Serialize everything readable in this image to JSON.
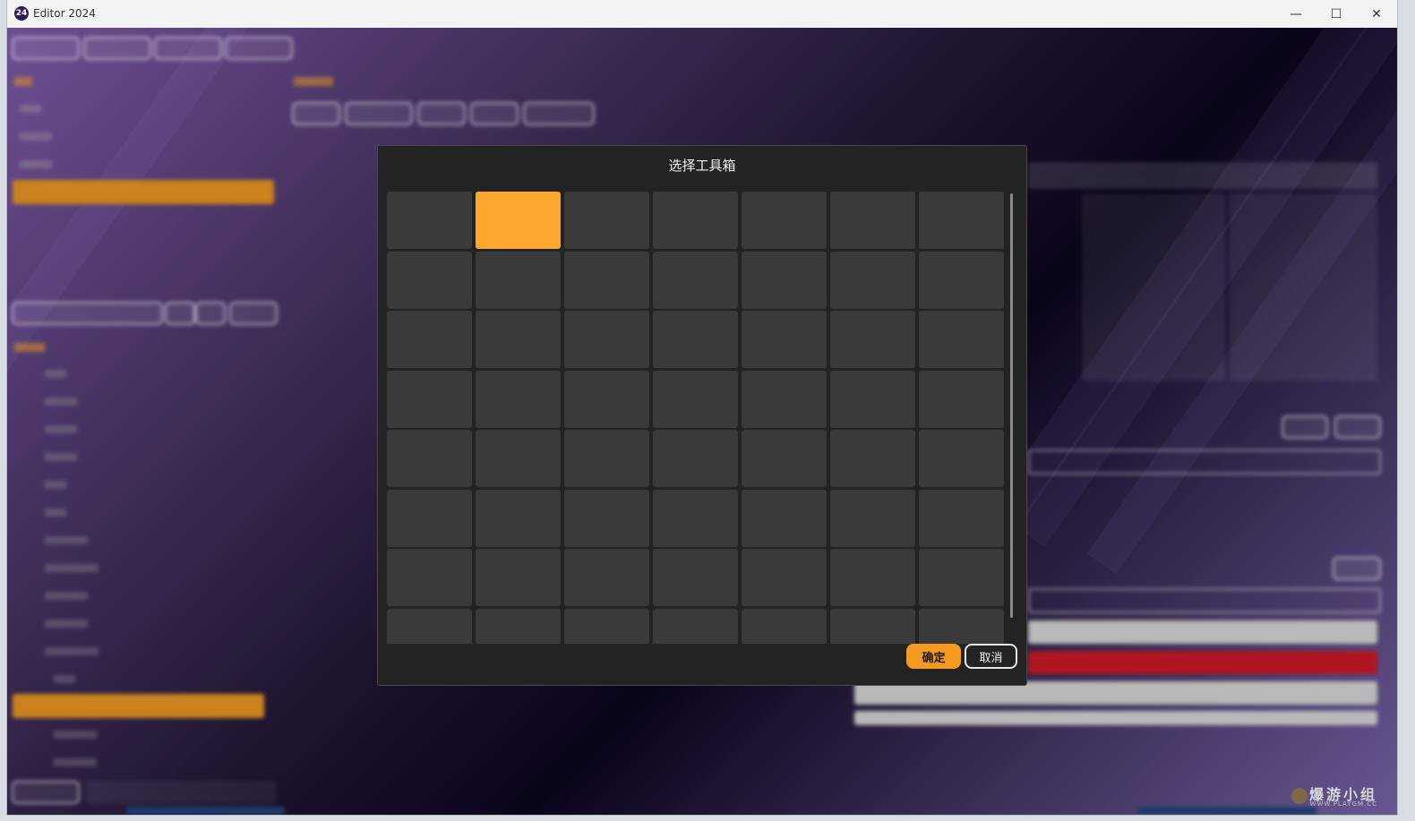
{
  "window": {
    "title": "Editor 2024",
    "icon_text": "24",
    "minimize_glyph": "—",
    "maximize_glyph": "☐",
    "close_glyph": "✕"
  },
  "dialog": {
    "title": "选择工具箱",
    "selected_index": 1,
    "rows_visible": 8,
    "columns": 7,
    "ok_label": "确定",
    "cancel_label": "取消"
  },
  "watermark": {
    "text": "爆游小组",
    "sub": "WWW.PLAYGM.CC"
  },
  "colors": {
    "accent": "#fca72d",
    "button_orange": "#f49b1f",
    "slot": "#3a3a3a",
    "dialog_bg": "#232323"
  }
}
